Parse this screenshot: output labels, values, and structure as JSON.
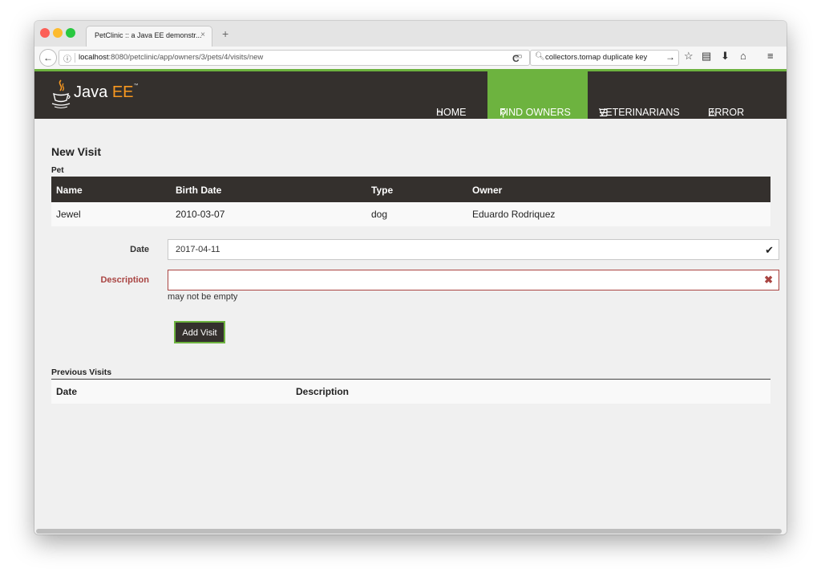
{
  "browser": {
    "tab_title": "PetClinic :: a Java EE demonstr...",
    "tab_close": "×",
    "new_tab": "+",
    "url_host": "localhost",
    "url_path": ":8080/petclinic/app/owners/3/pets/4/visits/new",
    "search_text": "collectors.tomap duplicate key"
  },
  "app": {
    "logo_java": "Java",
    "logo_ee": "EE",
    "logo_tm": "™",
    "menu": [
      {
        "label": "HOME",
        "icon": "home-icon"
      },
      {
        "label": "FIND OWNERS",
        "icon": "search-icon"
      },
      {
        "label": "VETERINARIANS",
        "icon": "list-icon"
      },
      {
        "label": "ERROR",
        "icon": "warning-icon"
      }
    ],
    "active_menu": "FIND OWNERS",
    "accent_color": "#6db33f",
    "header_color": "#34302d",
    "error_color": "#a94442"
  },
  "page": {
    "title": "New Visit",
    "pet_section": "Pet",
    "pet_table": {
      "headers": [
        "Name",
        "Birth Date",
        "Type",
        "Owner"
      ],
      "row": [
        "Jewel",
        "2010-03-07",
        "dog",
        "Eduardo Rodriquez"
      ]
    },
    "form": {
      "date_label": "Date",
      "date_value": "2017-04-11",
      "description_label": "Description",
      "description_value": "",
      "description_error": "may not be empty",
      "submit_label": "Add Visit"
    },
    "previous_visits": {
      "title": "Previous Visits",
      "headers": [
        "Date",
        "Description"
      ]
    }
  }
}
